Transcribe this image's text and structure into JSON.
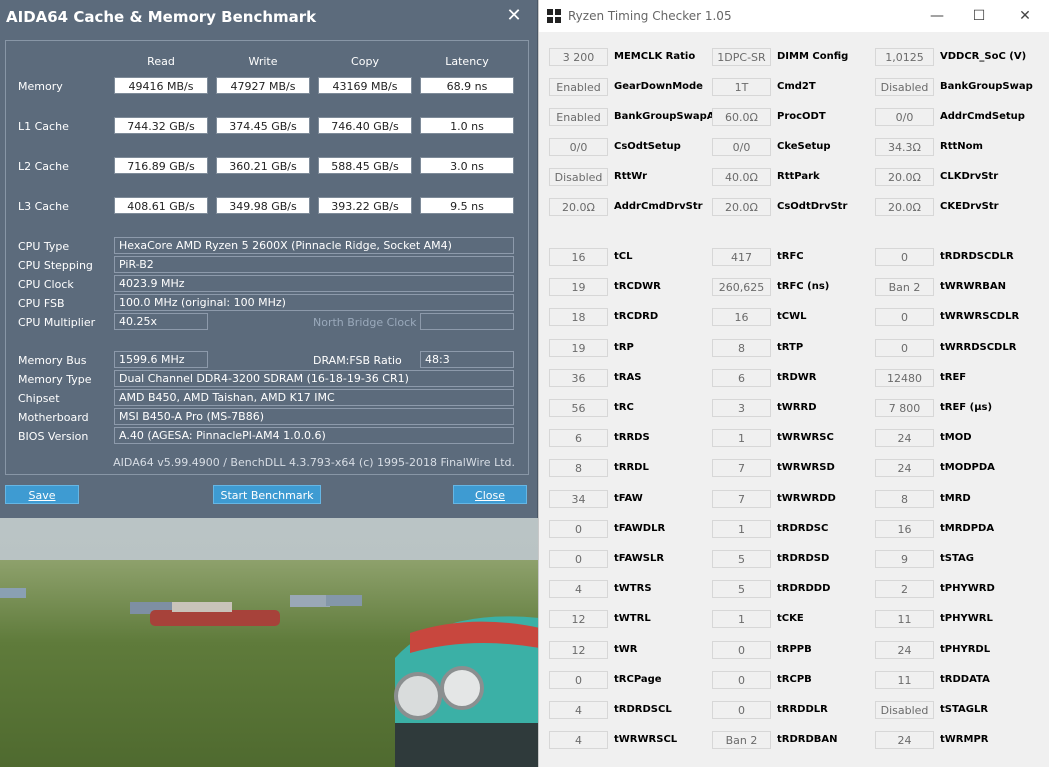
{
  "aida": {
    "title": "AIDA64 Cache & Memory Benchmark",
    "close_glyph": "✕",
    "columns": [
      "Read",
      "Write",
      "Copy",
      "Latency"
    ],
    "bench_rows": [
      {
        "label": "Memory",
        "read": "49416 MB/s",
        "write": "47927 MB/s",
        "copy": "43169 MB/s",
        "latency": "68.9 ns"
      },
      {
        "label": "L1 Cache",
        "read": "744.32 GB/s",
        "write": "374.45 GB/s",
        "copy": "746.40 GB/s",
        "latency": "1.0 ns"
      },
      {
        "label": "L2 Cache",
        "read": "716.89 GB/s",
        "write": "360.21 GB/s",
        "copy": "588.45 GB/s",
        "latency": "3.0 ns"
      },
      {
        "label": "L3 Cache",
        "read": "408.61 GB/s",
        "write": "349.98 GB/s",
        "copy": "393.22 GB/s",
        "latency": "9.5 ns"
      }
    ],
    "cpu_type_label": "CPU Type",
    "cpu_type": "HexaCore AMD Ryzen 5 2600X  (Pinnacle Ridge, Socket AM4)",
    "cpu_stepping_label": "CPU Stepping",
    "cpu_stepping": "PiR-B2",
    "cpu_clock_label": "CPU Clock",
    "cpu_clock": "4023.9 MHz",
    "cpu_fsb_label": "CPU FSB",
    "cpu_fsb": "100.0 MHz  (original: 100 MHz)",
    "cpu_mult_label": "CPU Multiplier",
    "cpu_mult": "40.25x",
    "nb_clock_label": "North Bridge Clock",
    "nb_clock": "",
    "mem_bus_label": "Memory Bus",
    "mem_bus": "1599.6 MHz",
    "dram_fsb_label": "DRAM:FSB Ratio",
    "dram_fsb": "48:3",
    "mem_type_label": "Memory Type",
    "mem_type": "Dual Channel DDR4-3200 SDRAM  (16-18-19-36 CR1)",
    "chipset_label": "Chipset",
    "chipset": "AMD B450, AMD Taishan, AMD K17 IMC",
    "mobo_label": "Motherboard",
    "mobo": "MSI B450-A Pro (MS-7B86)",
    "bios_label": "BIOS Version",
    "bios": "A.40  (AGESA: PinnaclePl-AM4 1.0.0.6)",
    "footer": "AIDA64 v5.99.4900 / BenchDLL 4.3.793-x64  (c) 1995-2018 FinalWire Ltd.",
    "save_label": "Save",
    "start_label": "Start Benchmark",
    "close_label": "Close"
  },
  "rtc": {
    "title": "Ryzen Timing Checker 1.05",
    "minimize": "—",
    "maximize": "☐",
    "close": "✕",
    "col1": [
      {
        "value": "3 200",
        "name": "MEMCLK Ratio"
      },
      {
        "value": "Enabled",
        "name": "GearDownMode"
      },
      {
        "value": "Enabled",
        "name": "BankGroupSwapAlt"
      },
      {
        "value": "0/0",
        "name": "CsOdtSetup"
      },
      {
        "value": "Disabled",
        "name": "RttWr"
      },
      {
        "value": "20.0Ω",
        "name": "AddrCmdDrvStr"
      }
    ],
    "col2": [
      {
        "value": "1DPC-SR",
        "name": "DIMM Config"
      },
      {
        "value": "1T",
        "name": "Cmd2T"
      },
      {
        "value": "60.0Ω",
        "name": "ProcODT"
      },
      {
        "value": "0/0",
        "name": "CkeSetup"
      },
      {
        "value": "40.0Ω",
        "name": "RttPark"
      },
      {
        "value": "20.0Ω",
        "name": "CsOdtDrvStr"
      }
    ],
    "col3": [
      {
        "value": "1,0125",
        "name": "VDDCR_SoC (V)"
      },
      {
        "value": "Disabled",
        "name": "BankGroupSwap"
      },
      {
        "value": "0/0",
        "name": "AddrCmdSetup"
      },
      {
        "value": "34.3Ω",
        "name": "RttNom"
      },
      {
        "value": "20.0Ω",
        "name": "CLKDrvStr"
      },
      {
        "value": "20.0Ω",
        "name": "CKEDrvStr"
      }
    ],
    "tcol1": [
      {
        "value": "16",
        "name": "tCL"
      },
      {
        "value": "19",
        "name": "tRCDWR"
      },
      {
        "value": "18",
        "name": "tRCDRD"
      },
      {
        "value": "19",
        "name": "tRP"
      },
      {
        "value": "36",
        "name": "tRAS"
      },
      {
        "value": "56",
        "name": "tRC"
      },
      {
        "value": "6",
        "name": "tRRDS"
      },
      {
        "value": "8",
        "name": "tRRDL"
      },
      {
        "value": "34",
        "name": "tFAW"
      },
      {
        "value": "0",
        "name": "tFAWDLR"
      },
      {
        "value": "0",
        "name": "tFAWSLR"
      },
      {
        "value": "4",
        "name": "tWTRS"
      },
      {
        "value": "12",
        "name": "tWTRL"
      },
      {
        "value": "12",
        "name": "tWR"
      },
      {
        "value": "0",
        "name": "tRCPage"
      },
      {
        "value": "4",
        "name": "tRDRDSCL"
      },
      {
        "value": "4",
        "name": "tWRWRSCL"
      }
    ],
    "tcol2": [
      {
        "value": "417",
        "name": "tRFC"
      },
      {
        "value": "260,625",
        "name": "tRFC (ns)"
      },
      {
        "value": "16",
        "name": "tCWL"
      },
      {
        "value": "8",
        "name": "tRTP"
      },
      {
        "value": "6",
        "name": "tRDWR"
      },
      {
        "value": "3",
        "name": "tWRRD"
      },
      {
        "value": "1",
        "name": "tWRWRSC"
      },
      {
        "value": "7",
        "name": "tWRWRSD"
      },
      {
        "value": "7",
        "name": "tWRWRDD"
      },
      {
        "value": "1",
        "name": "tRDRDSC"
      },
      {
        "value": "5",
        "name": "tRDRDSD"
      },
      {
        "value": "5",
        "name": "tRDRDDD"
      },
      {
        "value": "1",
        "name": "tCKE"
      },
      {
        "value": "0",
        "name": "tRPPB"
      },
      {
        "value": "0",
        "name": "tRCPB"
      },
      {
        "value": "0",
        "name": "tRRDDLR"
      },
      {
        "value": "Ban 2",
        "name": "tRDRDBAN"
      }
    ],
    "tcol3": [
      {
        "value": "0",
        "name": "tRDRDSCDLR"
      },
      {
        "value": "Ban 2",
        "name": "tWRWRBAN"
      },
      {
        "value": "0",
        "name": "tWRWRSCDLR"
      },
      {
        "value": "0",
        "name": "tWRRDSCDLR"
      },
      {
        "value": "12480",
        "name": "tREF"
      },
      {
        "value": "7 800",
        "name": "tREF (µs)"
      },
      {
        "value": "24",
        "name": "tMOD"
      },
      {
        "value": "24",
        "name": "tMODPDA"
      },
      {
        "value": "8",
        "name": "tMRD"
      },
      {
        "value": "16",
        "name": "tMRDPDA"
      },
      {
        "value": "9",
        "name": "tSTAG"
      },
      {
        "value": "2",
        "name": "tPHYWRD"
      },
      {
        "value": "11",
        "name": "tPHYWRL"
      },
      {
        "value": "24",
        "name": "tPHYRDL"
      },
      {
        "value": "11",
        "name": "tRDDATA"
      },
      {
        "value": "Disabled",
        "name": "tSTAGLR"
      },
      {
        "value": "24",
        "name": "tWRMPR"
      }
    ]
  }
}
